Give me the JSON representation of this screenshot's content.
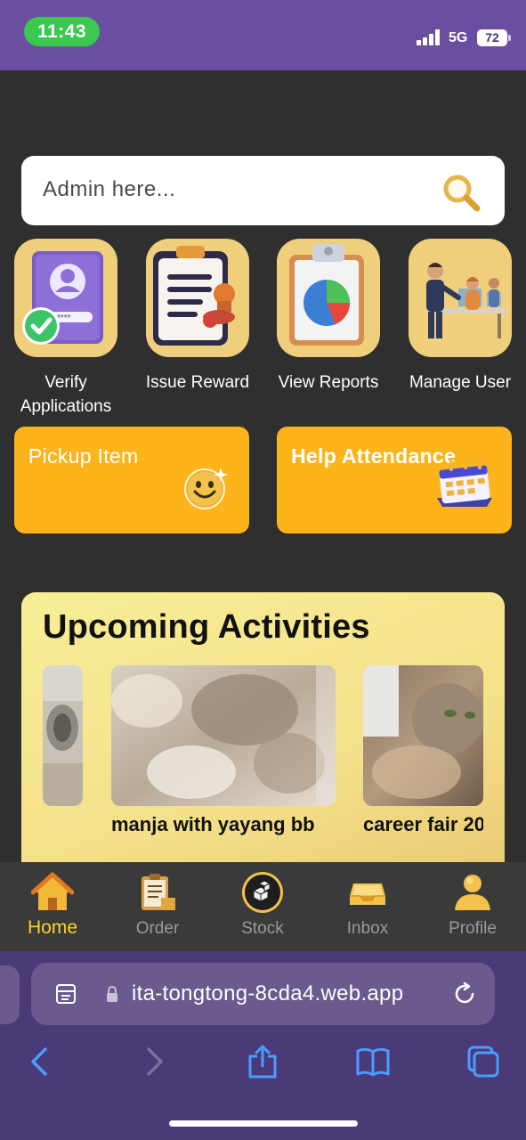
{
  "status_bar": {
    "time": "11:43",
    "network": "5G",
    "battery": "72"
  },
  "search": {
    "placeholder": "Admin here..."
  },
  "quick_actions": [
    {
      "label": "Verify Applications",
      "icon": "verify-id-icon"
    },
    {
      "label": "Issue Reward",
      "icon": "clipboard-stamp-icon"
    },
    {
      "label": "View Reports",
      "icon": "pie-chart-report-icon"
    },
    {
      "label": "Manage User",
      "icon": "office-team-icon"
    }
  ],
  "cards": [
    {
      "label": "Pickup Item",
      "icon": "smiley-icon"
    },
    {
      "label": "Help Attendance",
      "icon": "calendar-icon"
    }
  ],
  "activities": {
    "title": "Upcoming Activities",
    "items": [
      {
        "caption": ""
      },
      {
        "caption": "manja with yayang bb"
      },
      {
        "caption": "career fair 20"
      }
    ]
  },
  "bottom_nav": {
    "items": [
      {
        "label": "Home",
        "icon": "home-icon",
        "active": true
      },
      {
        "label": "Order",
        "icon": "order-clipboard-icon",
        "active": false
      },
      {
        "label": "Stock",
        "icon": "stock-boxes-icon",
        "active": false
      },
      {
        "label": "Inbox",
        "icon": "inbox-tray-icon",
        "active": false
      },
      {
        "label": "Profile",
        "icon": "profile-icon",
        "active": false
      }
    ]
  },
  "browser": {
    "url": "ita-tongtong-8cda4.web.app"
  },
  "colors": {
    "accent": "#fcb41a",
    "active_nav": "#ffd32a",
    "status_bar": "#6a4fa0",
    "background": "#2f2f2f"
  }
}
